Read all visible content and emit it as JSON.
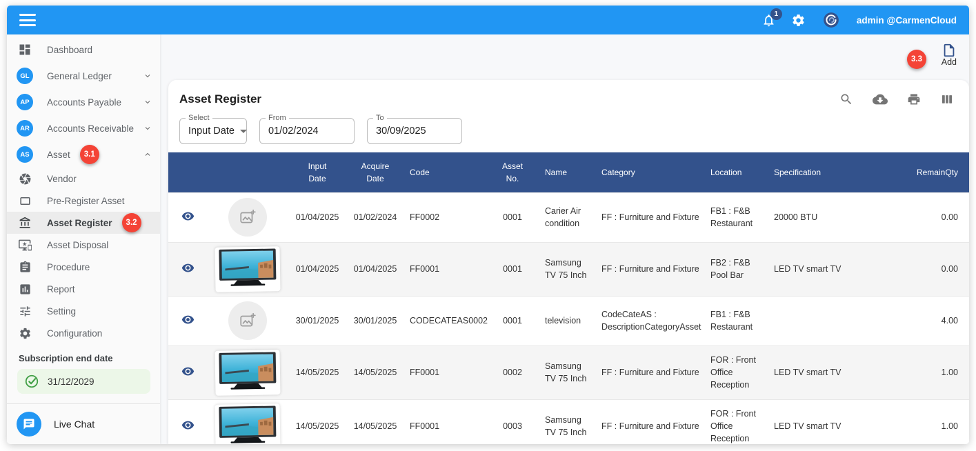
{
  "colors": {
    "accent_blue": "#2196f3",
    "navy": "#33528c",
    "badge_red": "#f44336",
    "success_green": "#43a047",
    "header_text": "#ffffff"
  },
  "topbar": {
    "user": "admin @CarmenCloud",
    "notification_count": "1",
    "icons": [
      "hamburger-icon",
      "bell-icon",
      "gear-icon",
      "avatar-logo"
    ]
  },
  "sidebar": {
    "items": [
      {
        "label": "Dashboard",
        "icon": "dashboard-icon"
      },
      {
        "label": "General Ledger",
        "avatar": "GL",
        "chevron": "down"
      },
      {
        "label": "Accounts Payable",
        "avatar": "AP",
        "chevron": "down"
      },
      {
        "label": "Accounts Receivable",
        "avatar": "AR",
        "chevron": "down"
      },
      {
        "label": "Asset",
        "avatar": "AS",
        "badge": "3.1",
        "chevron": "up"
      }
    ],
    "asset_subitems": [
      {
        "label": "Vendor",
        "icon": "camera-wheel-icon"
      },
      {
        "label": "Pre-Register Asset",
        "icon": "web-asset-icon"
      },
      {
        "label": "Asset Register",
        "icon": "bank-icon",
        "badge": "3.2",
        "active": true
      },
      {
        "label": "Asset Disposal",
        "icon": "devices-star-icon"
      },
      {
        "label": "Procedure",
        "icon": "clipboard-icon"
      },
      {
        "label": "Report",
        "icon": "bar-chart-icon"
      },
      {
        "label": "Setting",
        "icon": "sliders-icon"
      },
      {
        "label": "Configuration",
        "icon": "gear-icon"
      }
    ],
    "subscription": {
      "label": "Subscription end date",
      "date": "31/12/2029",
      "icon": "check-circle-icon"
    },
    "live_chat": {
      "label": "Live Chat",
      "icon": "chat-bubble-icon"
    }
  },
  "main": {
    "add_button": {
      "label": "Add",
      "badge": "3.3",
      "icon": "document-add-icon"
    },
    "card": {
      "title": "Asset Register",
      "toolbar_icons": [
        "search-icon",
        "cloud-download-icon",
        "print-icon",
        "columns-icon"
      ],
      "filters": {
        "select": {
          "label": "Select",
          "value": "Input Date"
        },
        "from": {
          "label": "From",
          "value": "01/02/2024"
        },
        "to": {
          "label": "To",
          "value": "30/09/2025"
        }
      },
      "table": {
        "columns": [
          "Input Date",
          "Acquire Date",
          "Code",
          "Asset No.",
          "Name",
          "Category",
          "Location",
          "Specification",
          "RemainQty"
        ],
        "rows": [
          {
            "has_image": false,
            "input_date": "01/04/2025",
            "acquire_date": "01/02/2024",
            "code": "FF0002",
            "asset_no": "0001",
            "name": "Carier Air condition",
            "category": "FF : Furniture and Fixture",
            "location": "FB1 : F&B Restaurant",
            "specification": "20000 BTU",
            "remain_qty": "0.00"
          },
          {
            "has_image": true,
            "input_date": "01/04/2025",
            "acquire_date": "01/04/2025",
            "code": "FF0001",
            "asset_no": "0001",
            "name": "Samsung TV 75 Inch",
            "category": "FF : Furniture and Fixture",
            "location": "FB2 : F&B Pool Bar",
            "specification": "LED TV smart TV",
            "remain_qty": "0.00"
          },
          {
            "has_image": false,
            "input_date": "30/01/2025",
            "acquire_date": "30/01/2025",
            "code": "CODECATEAS0002",
            "asset_no": "0001",
            "name": "television",
            "category": "CodeCateAS : DescriptionCategoryAsset",
            "location": "FB1 : F&B Restaurant",
            "specification": "",
            "remain_qty": "4.00"
          },
          {
            "has_image": true,
            "input_date": "14/05/2025",
            "acquire_date": "14/05/2025",
            "code": "FF0001",
            "asset_no": "0002",
            "name": "Samsung TV 75 Inch",
            "category": "FF : Furniture and Fixture",
            "location": "FOR : Front Office Reception",
            "specification": "LED TV smart TV",
            "remain_qty": "1.00"
          },
          {
            "has_image": true,
            "input_date": "14/05/2025",
            "acquire_date": "14/05/2025",
            "code": "FF0001",
            "asset_no": "0003",
            "name": "Samsung TV 75 Inch",
            "category": "FF : Furniture and Fixture",
            "location": "FOR : Front Office Reception",
            "specification": "LED TV smart TV",
            "remain_qty": "1.00"
          }
        ]
      }
    }
  }
}
